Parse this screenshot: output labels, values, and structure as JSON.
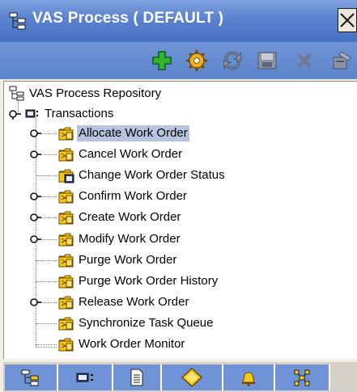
{
  "window": {
    "title": "VAS Process ( DEFAULT )",
    "close_icon": "close-box-icon"
  },
  "toolbar": {
    "buttons": [
      {
        "name": "add",
        "icon": "green-plus-icon"
      },
      {
        "name": "settings",
        "icon": "gear-icon"
      },
      {
        "name": "refresh",
        "icon": "refresh-icon"
      },
      {
        "name": "save",
        "icon": "save-icon"
      },
      {
        "name": "delete",
        "icon": "delete-x-icon"
      },
      {
        "name": "properties",
        "icon": "properties-icon"
      }
    ]
  },
  "tree": {
    "root": "VAS Process Repository",
    "group": "Transactions",
    "selected": "Allocate Work Order",
    "items": [
      {
        "label": "Allocate Work Order",
        "expandable": true
      },
      {
        "label": "Cancel Work Order",
        "expandable": true
      },
      {
        "label": "Change Work Order Status",
        "expandable": false
      },
      {
        "label": "Confirm Work Order",
        "expandable": true
      },
      {
        "label": "Create Work Order",
        "expandable": true
      },
      {
        "label": "Modify Work Order",
        "expandable": true
      },
      {
        "label": "Purge Work Order",
        "expandable": false
      },
      {
        "label": "Purge Work Order History",
        "expandable": false
      },
      {
        "label": "Release Work Order",
        "expandable": true
      },
      {
        "label": "Synchronize Task Queue",
        "expandable": false
      },
      {
        "label": "Work Order Monitor",
        "expandable": false
      }
    ]
  },
  "tabs": [
    {
      "name": "hierarchy",
      "icon": "hierarchy-icon"
    },
    {
      "name": "transactions",
      "icon": "transaction-icon"
    },
    {
      "name": "document",
      "icon": "document-icon"
    },
    {
      "name": "condition",
      "icon": "diamond-icon"
    },
    {
      "name": "alert",
      "icon": "bell-icon"
    },
    {
      "name": "pipeline",
      "icon": "pipeline-icon"
    }
  ],
  "colors": {
    "titlebar": "#5a82cf",
    "selection": "#b6c4e0",
    "folder": "#f5c518"
  }
}
